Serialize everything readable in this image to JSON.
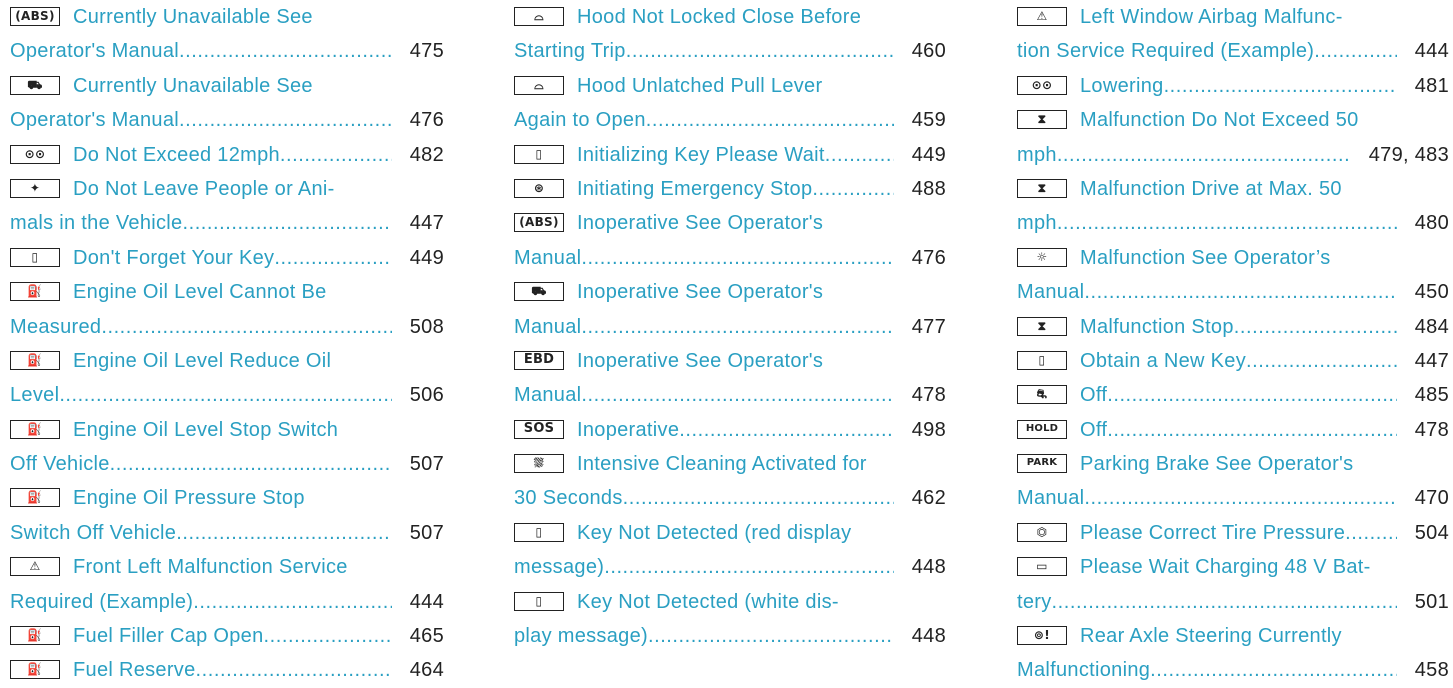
{
  "columns": [
    [
      {
        "icon": "abs-icon",
        "glyph": "(ABS)",
        "lines": [
          "Currently Unavailable See",
          "Operator's Manual"
        ],
        "page": "475"
      },
      {
        "icon": "esp-icon",
        "glyph": "⛟",
        "lines": [
          "Currently Unavailable See",
          "Operator's Manual"
        ],
        "page": "476"
      },
      {
        "icon": "vehicle-level-icon",
        "glyph": "⊙⊙",
        "lines": [
          "Do Not Exceed 12mph"
        ],
        "page": "482"
      },
      {
        "icon": "child-seat-icon",
        "glyph": "✦",
        "lines": [
          "Do Not Leave People or Ani-",
          "mals in the Vehicle"
        ],
        "page": "447"
      },
      {
        "icon": "key-icon",
        "glyph": "▯",
        "lines": [
          "Don't Forget Your Key"
        ],
        "page": "449"
      },
      {
        "icon": "oil-can-icon",
        "glyph": "⛽",
        "lines": [
          "Engine Oil Level Cannot Be",
          "Measured"
        ],
        "page": "508"
      },
      {
        "icon": "oil-can-icon",
        "glyph": "⛽",
        "lines": [
          "Engine Oil Level Reduce Oil",
          "Level"
        ],
        "page": "506"
      },
      {
        "icon": "oil-can-icon",
        "glyph": "⛽",
        "lines": [
          "Engine Oil Level Stop Switch",
          "Off Vehicle"
        ],
        "page": "507"
      },
      {
        "icon": "oil-can-icon",
        "glyph": "⛽",
        "lines": [
          "Engine Oil Pressure Stop",
          "Switch Off Vehicle"
        ],
        "page": "507"
      },
      {
        "icon": "airbag-icon",
        "glyph": "⚠",
        "lines": [
          "Front Left Malfunction Service",
          "Required (Example)"
        ],
        "page": "444"
      },
      {
        "icon": "fuel-pump-icon",
        "glyph": "⛽",
        "lines": [
          "Fuel Filler Cap Open"
        ],
        "page": "465"
      },
      {
        "icon": "fuel-pump-icon",
        "glyph": "⛽",
        "lines": [
          "Fuel Reserve"
        ],
        "page": "464"
      }
    ],
    [
      {
        "icon": "hood-icon",
        "glyph": "⌓",
        "lines": [
          "Hood Not Locked Close Before",
          "Starting Trip"
        ],
        "page": "460"
      },
      {
        "icon": "hood-icon",
        "glyph": "⌓",
        "lines": [
          "Hood Unlatched Pull Lever",
          "Again to Open"
        ],
        "page": "459"
      },
      {
        "icon": "key-icon",
        "glyph": "▯",
        "lines": [
          "Initializing Key Please Wait"
        ],
        "page": "449"
      },
      {
        "icon": "emergency-stop-icon",
        "glyph": "⊛",
        "lines": [
          "Initiating Emergency Stop"
        ],
        "page": "488"
      },
      {
        "icon": "abs-icon",
        "glyph": "(ABS)",
        "lines": [
          "Inoperative See Operator's",
          "Manual"
        ],
        "page": "476"
      },
      {
        "icon": "esp-icon",
        "glyph": "⛟",
        "lines": [
          "Inoperative See Operator's",
          "Manual"
        ],
        "page": "477"
      },
      {
        "icon": "ebd-icon",
        "glyph": "EBD",
        "lines": [
          "Inoperative See Operator's",
          "Manual"
        ],
        "page": "478"
      },
      {
        "icon": "sos-icon",
        "glyph": "SOS",
        "lines": [
          "Inoperative"
        ],
        "page": "498"
      },
      {
        "icon": "windshield-washer-icon",
        "glyph": "⛆",
        "lines": [
          "Intensive Cleaning Activated for",
          "30 Seconds"
        ],
        "page": "462"
      },
      {
        "icon": "key-icon",
        "glyph": "▯",
        "lines": [
          "Key Not Detected  (red display",
          "message)"
        ],
        "page": "448"
      },
      {
        "icon": "key-icon",
        "glyph": "▯",
        "lines": [
          "Key Not Detected  (white dis-",
          "play message)"
        ],
        "page": "448"
      }
    ],
    [
      {
        "icon": "airbag-icon",
        "glyph": "⚠",
        "lines": [
          "Left Window Airbag Malfunc-",
          "tion Service Required (Example)"
        ],
        "page": "444"
      },
      {
        "icon": "vehicle-level-icon",
        "glyph": "⊙⊙",
        "lines": [
          "Lowering"
        ],
        "page": "481"
      },
      {
        "icon": "suspension-icon",
        "glyph": "⧗",
        "lines": [
          "Malfunction Do Not Exceed 50",
          "mph"
        ],
        "page": "479, 483"
      },
      {
        "icon": "suspension-icon",
        "glyph": "⧗",
        "lines": [
          "Malfunction Drive at Max. 50",
          "mph"
        ],
        "page": "480"
      },
      {
        "icon": "light-icon",
        "glyph": "☼",
        "lines": [
          "Malfunction See Operator’s",
          "Manual"
        ],
        "page": "450"
      },
      {
        "icon": "suspension-icon",
        "glyph": "⧗",
        "lines": [
          "Malfunction Stop"
        ],
        "page": "484"
      },
      {
        "icon": "key-icon",
        "glyph": "▯",
        "lines": [
          "Obtain a New Key"
        ],
        "page": "447"
      },
      {
        "icon": "distance-assist-off-icon",
        "glyph": "⛐",
        "lines": [
          "Off"
        ],
        "page": "485"
      },
      {
        "icon": "hold-icon",
        "glyph": "HOLD",
        "lines": [
          "Off"
        ],
        "page": "478"
      },
      {
        "icon": "park-icon",
        "glyph": "PARK",
        "lines": [
          "Parking Brake See Operator's",
          "Manual"
        ],
        "page": "470"
      },
      {
        "icon": "tire-pressure-icon",
        "glyph": "⏣",
        "lines": [
          "Please Correct Tire Pressure"
        ],
        "page": "504"
      },
      {
        "icon": "battery-icon",
        "glyph": "▭",
        "lines": [
          "Please Wait Charging 48 V Bat-",
          "tery"
        ],
        "page": "501"
      },
      {
        "icon": "rear-axle-steering-icon",
        "glyph": "⊚!",
        "lines": [
          "Rear Axle Steering Currently",
          "Malfunctioning"
        ],
        "page": "458"
      }
    ]
  ]
}
